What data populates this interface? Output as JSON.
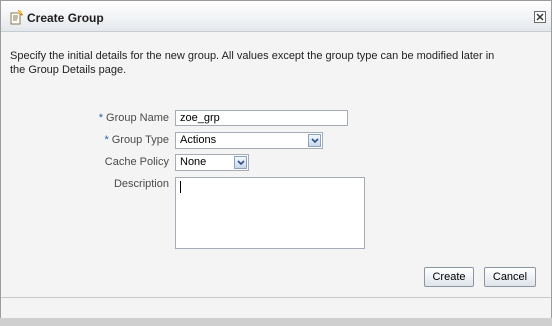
{
  "dialog": {
    "title": "Create Group",
    "title_icon": "group-create-icon",
    "close_icon": "close-icon"
  },
  "intro_text": "Specify the initial details for the new group. All values except the group type can be modified later in the Group Details page.",
  "form": {
    "required_marker": "*",
    "group_name": {
      "label": "Group Name",
      "value": "zoe_grp"
    },
    "group_type": {
      "label": "Group Type",
      "value": "Actions"
    },
    "cache_policy": {
      "label": "Cache Policy",
      "value": "None"
    },
    "description": {
      "label": "Description",
      "value": ""
    }
  },
  "buttons": {
    "create": "Create",
    "cancel": "Cancel"
  },
  "colors": {
    "required": "#2a5fa0",
    "label": "#4a4a4a",
    "dropdown_arrow_bg": "#c9d8ea"
  }
}
